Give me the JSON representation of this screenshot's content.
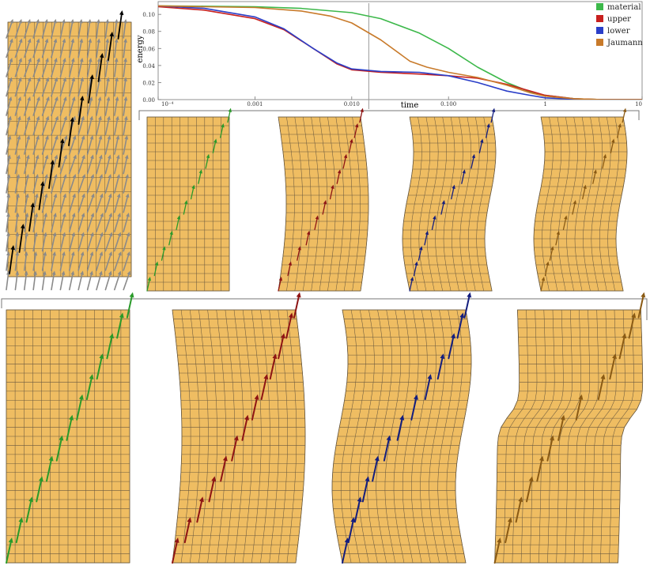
{
  "chart_data": {
    "type": "line",
    "title": "",
    "xlabel": "time",
    "ylabel": "energy",
    "x_scale": "log",
    "xlim": [
      0.0001,
      10
    ],
    "ylim": [
      0,
      0.115
    ],
    "x_ticks": [
      {
        "value": 0.0001,
        "label": "10⁻⁴"
      },
      {
        "value": 0.001,
        "label": "0.001"
      },
      {
        "value": 0.01,
        "label": "0.010"
      },
      {
        "value": 0.1,
        "label": "0.100"
      },
      {
        "value": 1,
        "label": "1"
      },
      {
        "value": 10,
        "label": "10"
      }
    ],
    "y_ticks": [
      {
        "value": 0,
        "label": "0.00"
      },
      {
        "value": 0.02,
        "label": "0.02"
      },
      {
        "value": 0.04,
        "label": "0.04"
      },
      {
        "value": 0.06,
        "label": "0.06"
      },
      {
        "value": 0.08,
        "label": "0.08"
      },
      {
        "value": 0.1,
        "label": "0.10"
      }
    ],
    "legend_position": "top-right",
    "vertical_marker": 0.015,
    "series": [
      {
        "name": "material",
        "color": "#3cb84a",
        "x": [
          0.0001,
          0.0003,
          0.001,
          0.003,
          0.01,
          0.02,
          0.05,
          0.1,
          0.2,
          0.4,
          0.7,
          1,
          2,
          4,
          10
        ],
        "y": [
          0.11,
          0.1095,
          0.109,
          0.107,
          0.102,
          0.095,
          0.078,
          0.06,
          0.038,
          0.02,
          0.009,
          0.005,
          0.001,
          0.0,
          0.0
        ]
      },
      {
        "name": "upper",
        "color": "#c8201e",
        "x": [
          0.0001,
          0.0003,
          0.001,
          0.002,
          0.004,
          0.007,
          0.01,
          0.02,
          0.05,
          0.1,
          0.2,
          0.4,
          0.7,
          1,
          2,
          4,
          10
        ],
        "y": [
          0.109,
          0.105,
          0.095,
          0.082,
          0.06,
          0.042,
          0.035,
          0.032,
          0.03,
          0.028,
          0.025,
          0.018,
          0.01,
          0.005,
          0.001,
          0.0,
          0.0
        ]
      },
      {
        "name": "lower",
        "color": "#2a3ec8",
        "x": [
          0.0001,
          0.0003,
          0.001,
          0.002,
          0.004,
          0.007,
          0.01,
          0.02,
          0.05,
          0.1,
          0.2,
          0.4,
          0.7,
          1,
          2,
          4,
          10
        ],
        "y": [
          0.11,
          0.107,
          0.097,
          0.083,
          0.06,
          0.043,
          0.036,
          0.033,
          0.032,
          0.028,
          0.02,
          0.01,
          0.005,
          0.002,
          0.0005,
          0.0,
          0.0
        ]
      },
      {
        "name": "Jaumann",
        "color": "#c87a2a",
        "x": [
          0.0001,
          0.0003,
          0.001,
          0.003,
          0.006,
          0.01,
          0.02,
          0.04,
          0.06,
          0.1,
          0.2,
          0.4,
          0.7,
          1,
          2,
          4,
          10
        ],
        "y": [
          0.11,
          0.109,
          0.108,
          0.104,
          0.098,
          0.09,
          0.07,
          0.045,
          0.038,
          0.032,
          0.026,
          0.017,
          0.008,
          0.004,
          0.001,
          0.0,
          0.0
        ]
      }
    ]
  },
  "panels": {
    "mesh_fill": "#efbd62",
    "mesh_line": "#6b5a3f",
    "grid_left": {
      "arrow_colors": [
        "#000000",
        "#8a8a8a"
      ]
    },
    "small": [
      {
        "series": "material",
        "arrow_color": "#2a9a2a",
        "shape": "straight"
      },
      {
        "series": "upper",
        "arrow_color": "#8e1414",
        "shape": "bent"
      },
      {
        "series": "lower",
        "arrow_color": "#141e7e",
        "shape": "wavy"
      },
      {
        "series": "Jaumann",
        "arrow_color": "#8a5a14",
        "shape": "wavy"
      }
    ],
    "large": [
      {
        "series": "material",
        "arrow_color": "#2a9a2a",
        "shape": "straight"
      },
      {
        "series": "upper",
        "arrow_color": "#8e1414",
        "shape": "bent"
      },
      {
        "series": "lower",
        "arrow_color": "#141e7e",
        "shape": "wavy"
      },
      {
        "series": "Jaumann",
        "arrow_color": "#8a5a14",
        "shape": "step"
      }
    ]
  }
}
